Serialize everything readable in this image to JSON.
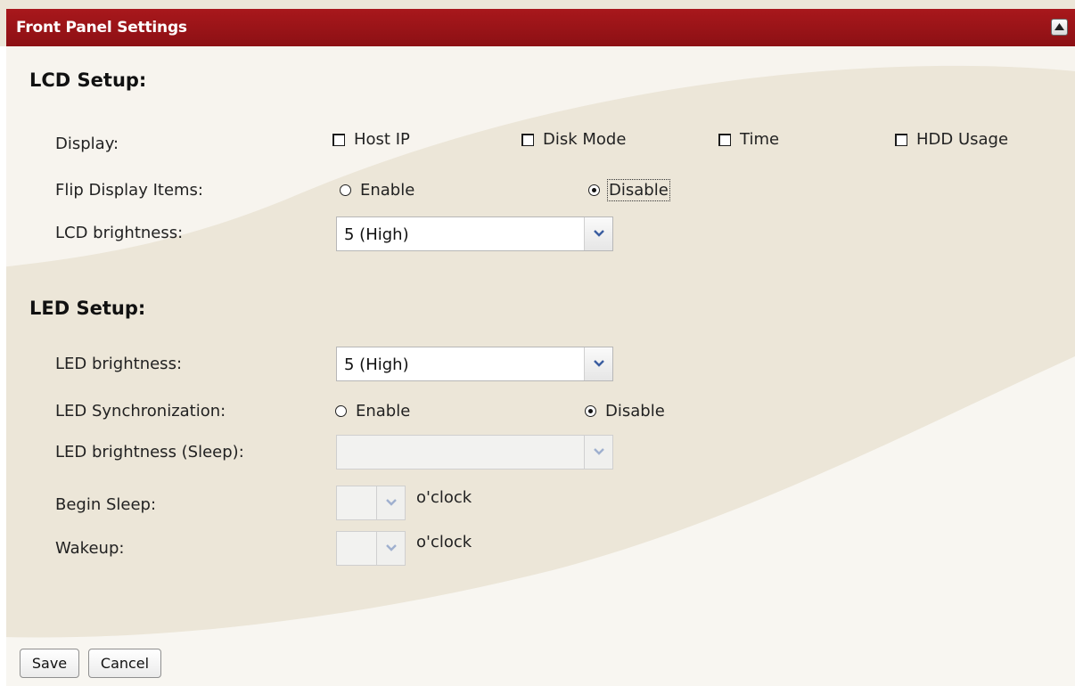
{
  "panel": {
    "title": "Front Panel Settings"
  },
  "lcd": {
    "heading": "LCD Setup:",
    "display_label": "Display:",
    "display_options": [
      {
        "label": "Host IP",
        "checked": false
      },
      {
        "label": "Disk Mode",
        "checked": false
      },
      {
        "label": "Time",
        "checked": false
      },
      {
        "label": "HDD Usage",
        "checked": false
      }
    ],
    "flip_label": "Flip Display Items:",
    "flip_enable": "Enable",
    "flip_disable": "Disable",
    "flip_selected": "Disable",
    "brightness_label": "LCD brightness:",
    "brightness_value": "5 (High)"
  },
  "led": {
    "heading": "LED Setup:",
    "brightness_label": "LED brightness:",
    "brightness_value": "5 (High)",
    "sync_label": "LED Synchronization:",
    "sync_enable": "Enable",
    "sync_disable": "Disable",
    "sync_selected": "Disable",
    "sleep_brightness_label": "LED brightness (Sleep):",
    "sleep_brightness_value": "",
    "begin_sleep_label": "Begin Sleep:",
    "begin_sleep_value": "",
    "begin_sleep_unit": "o'clock",
    "wakeup_label": "Wakeup:",
    "wakeup_value": "",
    "wakeup_unit": "o'clock"
  },
  "buttons": {
    "save": "Save",
    "cancel": "Cancel"
  },
  "colors": {
    "title_bar": "#9b1418",
    "background": "#ece6d8",
    "swoosh": "#f7f4ee",
    "select_arrow": "#3a5da0"
  },
  "icons": {
    "collapse": "collapse-up-icon",
    "dropdown": "chevron-down-icon"
  }
}
